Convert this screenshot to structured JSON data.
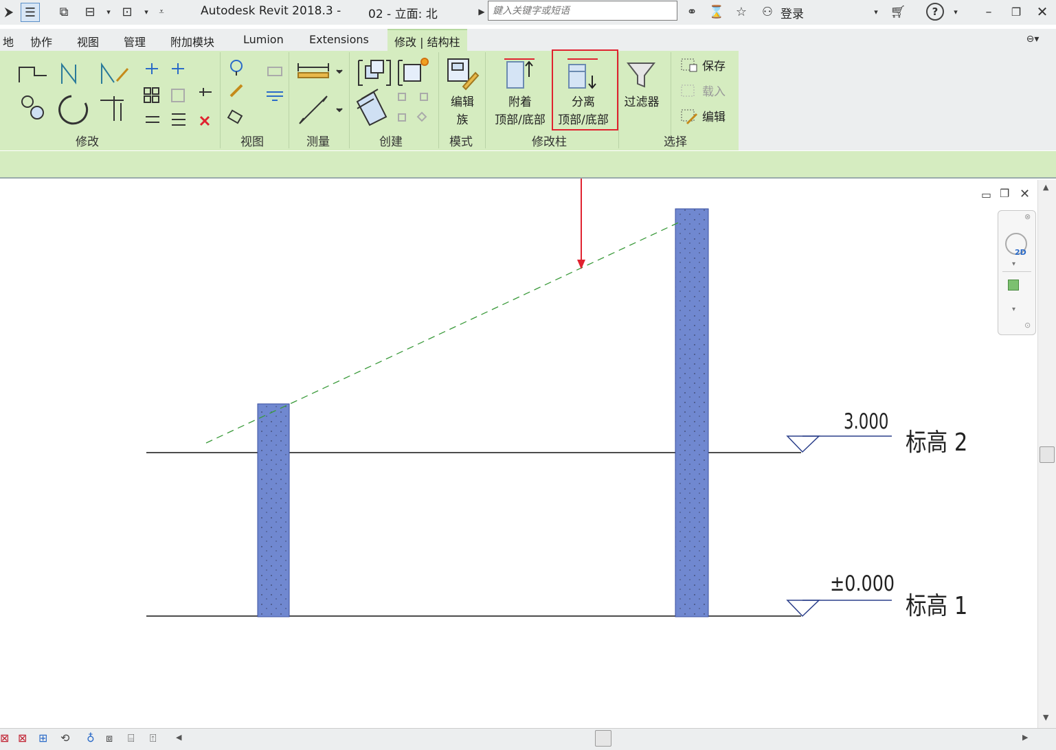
{
  "titlebar": {
    "app_title": "Autodesk Revit 2018.3 -",
    "view_title": "02 - 立面: 北",
    "search_placeholder": "鍵入关键字或短语",
    "login_label": "登录"
  },
  "tabs": [
    {
      "label": "地"
    },
    {
      "label": "协作"
    },
    {
      "label": "视图"
    },
    {
      "label": "管理"
    },
    {
      "label": "附加模块"
    },
    {
      "label": "Lumion"
    },
    {
      "label": "Extensions"
    },
    {
      "label": "修改 | 结构柱"
    }
  ],
  "ribbon": {
    "panels": {
      "modify": "修改",
      "view": "视图",
      "measure": "测量",
      "create": "创建",
      "mode": "模式",
      "modify_column": "修改柱",
      "select": "选择"
    },
    "edit_family": {
      "line1": "编辑",
      "line2": "族"
    },
    "attach": {
      "line1": "附着",
      "line2": "顶部/底部"
    },
    "detach": {
      "line1": "分离",
      "line2": "顶部/底部"
    },
    "filter": "过滤器",
    "save": "保存",
    "load": "载入",
    "edit": "编辑"
  },
  "levels": [
    {
      "name": "标高 2",
      "elevation": "3.000"
    },
    {
      "name": "标高 1",
      "elevation": "±0.000"
    }
  ],
  "navbar": {
    "wheel_label": "2D"
  },
  "colors": {
    "ribbon_green": "#d5ecc0",
    "column_fill": "#7088d0",
    "highlight_red": "#e0222f",
    "dash_green": "#3a9a3a"
  }
}
